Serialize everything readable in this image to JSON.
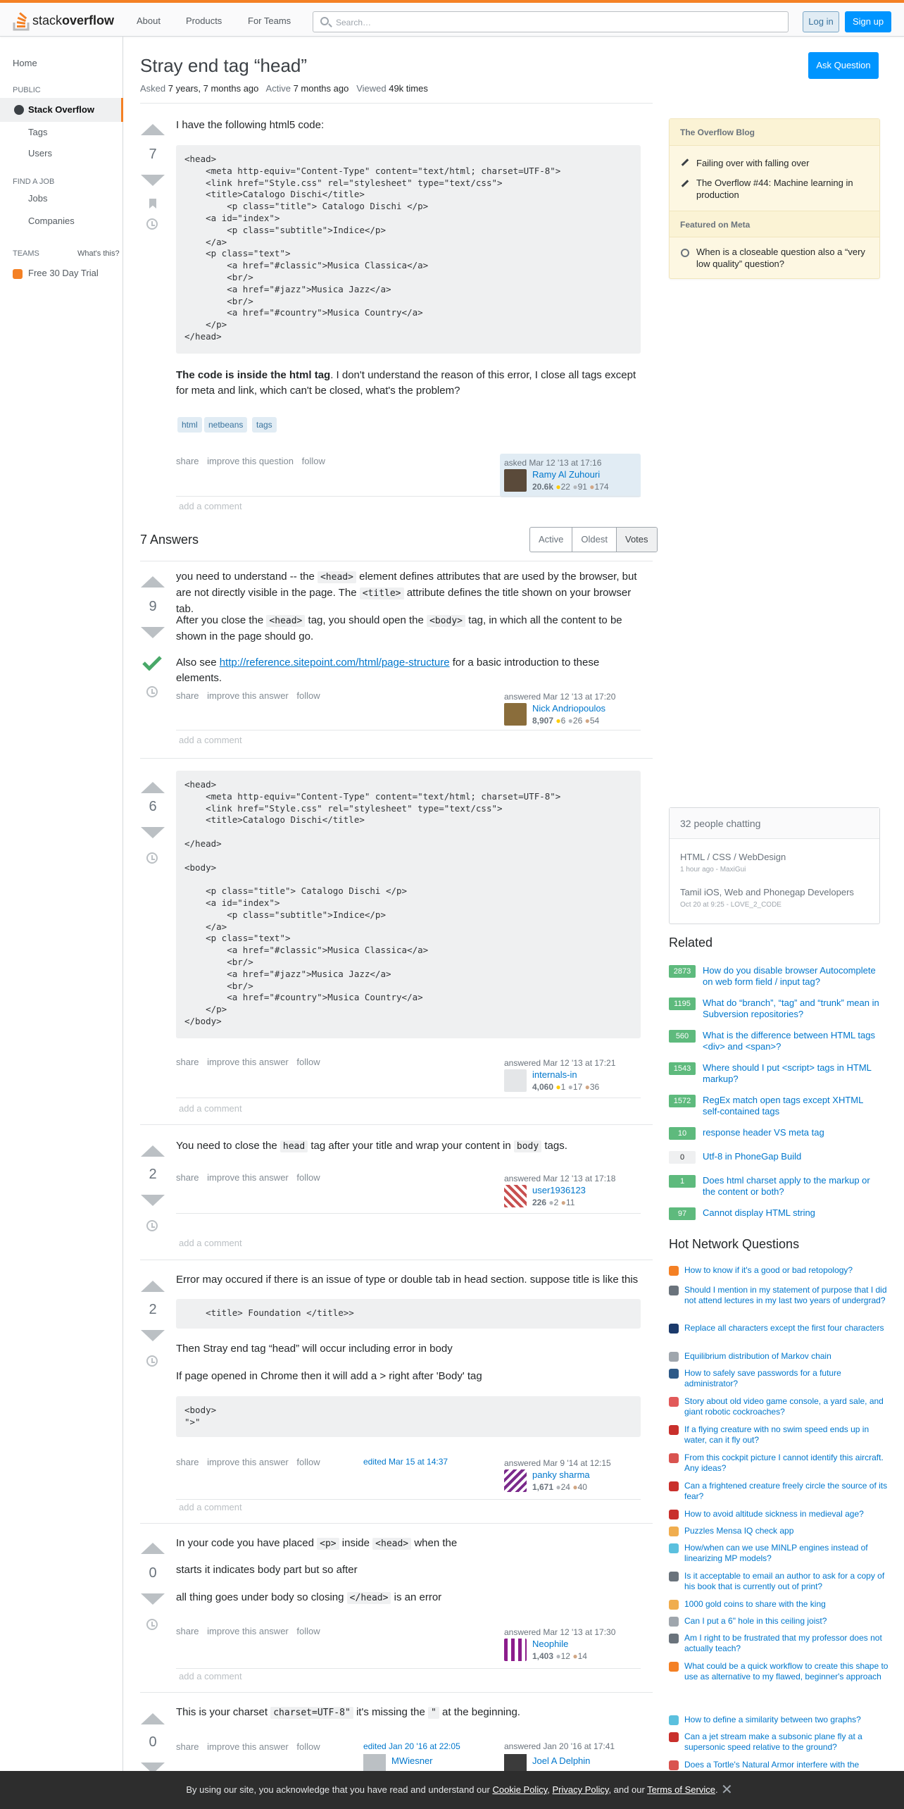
{
  "header": {
    "logo_text_1": "stack",
    "logo_text_2": "overflow",
    "nav": [
      "About",
      "Products",
      "For Teams"
    ],
    "search_placeholder": "Search…",
    "login": "Log in",
    "signup": "Sign up"
  },
  "leftnav": {
    "home": "Home",
    "public": "PUBLIC",
    "stack_overflow": "Stack Overflow",
    "tags": "Tags",
    "users": "Users",
    "find_job": "FIND A JOB",
    "jobs": "Jobs",
    "companies": "Companies",
    "teams": "TEAMS",
    "whats_this": "What's this?",
    "trial": "Free 30 Day Trial"
  },
  "question": {
    "title": "Stray end tag “head”",
    "ask_button": "Ask Question",
    "asked_label": "Asked",
    "asked_value": "7 years, 7 months ago",
    "active_label": "Active",
    "active_value": "7 months ago",
    "viewed_label": "Viewed",
    "viewed_value": "49k times",
    "votes": "7",
    "intro": "I have the following html5 code:",
    "code": "<head>\n    <meta http-equiv=\"Content-Type\" content=\"text/html; charset=UTF-8\">\n    <link href=\"Style.css\" rel=\"stylesheet\" type=\"text/css\">\n    <title>Catalogo Dischi</title>\n        <p class=\"title\"> Catalogo Dischi </p>\n    <a id=\"index\">\n        <p class=\"subtitle\">Indice</p>\n    </a>\n    <p class=\"text\">\n        <a href=\"#classic\">Musica Classica</a>\n        <br/>\n        <a href=\"#jazz\">Musica Jazz</a>\n        <br/>\n        <a href=\"#country\">Musica Country</a>\n    </p>\n</head>",
    "body_bold": "The code is inside the html tag",
    "body_rest": ". I don't understand the reason of this error, I close all tags except for meta and link, which can't be closed, what's the problem?",
    "tags": [
      "html",
      "netbeans",
      "tags"
    ],
    "menu": [
      "share",
      "improve this question",
      "follow"
    ],
    "owner": {
      "time": "asked Mar 12 '13 at 17:16",
      "name": "Ramy Al Zuhouri",
      "rep": "20.6k",
      "gold": "22",
      "silver": "91",
      "bronze": "174"
    },
    "add_comment": "add a comment"
  },
  "answers_header": {
    "count": "7 Answers",
    "tabs": [
      "Active",
      "Oldest",
      "Votes"
    ]
  },
  "answers": [
    {
      "votes": "9",
      "p1_a": "you need to understand -- the",
      "p1_code": "<head>",
      "p1_b": "element defines attributes that are used by the browser, but are not directly visible in the page. The",
      "p1_code2": "<title>",
      "p1_c": "attribute defines the title shown on your browser tab.",
      "p2_a": "After you close the",
      "p2_code": "<head>",
      "p2_b": "tag, you should open the",
      "p2_code2": "<body>",
      "p2_c": "tag, in which all the content to be shown in the page should go.",
      "p3_a": "Also see",
      "p3_link": "http://reference.sitepoint.com/html/page-structure",
      "p3_b": "for a basic introduction to these elements.",
      "menu": [
        "share",
        "improve this answer",
        "follow"
      ],
      "user": {
        "time": "answered Mar 12 '13 at 17:20",
        "name": "Nick Andriopoulos",
        "rep": "8,907",
        "gold": "6",
        "silver": "26",
        "bronze": "54"
      },
      "add_comment": "add a comment"
    },
    {
      "votes": "6",
      "code": "<head>\n    <meta http-equiv=\"Content-Type\" content=\"text/html; charset=UTF-8\">\n    <link href=\"Style.css\" rel=\"stylesheet\" type=\"text/css\">\n    <title>Catalogo Dischi</title>\n\n</head>\n\n<body>\n\n    <p class=\"title\"> Catalogo Dischi </p>\n    <a id=\"index\">\n        <p class=\"subtitle\">Indice</p>\n    </a>\n    <p class=\"text\">\n        <a href=\"#classic\">Musica Classica</a>\n        <br/>\n        <a href=\"#jazz\">Musica Jazz</a>\n        <br/>\n        <a href=\"#country\">Musica Country</a>\n    </p>\n</body>",
      "menu": [
        "share",
        "improve this answer",
        "follow"
      ],
      "user": {
        "time": "answered Mar 12 '13 at 17:21",
        "name": "internals-in",
        "rep": "4,060",
        "gold": "1",
        "silver": "17",
        "bronze": "36"
      },
      "add_comment": "add a comment"
    },
    {
      "votes": "2",
      "p_a": "You need to close the",
      "p_code": "head",
      "p_b": "tag after your title and wrap your content in",
      "p_code2": "body",
      "p_c": "tags.",
      "menu": [
        "share",
        "improve this answer",
        "follow"
      ],
      "user": {
        "time": "answered Mar 12 '13 at 17:18",
        "name": "user1936123",
        "rep": "226",
        "silver": "2",
        "bronze": "11"
      },
      "add_comment": "add a comment"
    },
    {
      "votes": "2",
      "p1": "Error may occured if there is an issue of type or double tab in head section. suppose title is like this",
      "code1": "    <title> Foundation </title>>",
      "p2": "Then Stray end tag “head” will occur including error in body",
      "p3": "If page opened in Chrome then it will add a > right after 'Body' tag",
      "code2": "<body>\n\">\"",
      "menu": [
        "share",
        "improve this answer",
        "follow"
      ],
      "edited": "edited Mar 15 at 14:37",
      "user": {
        "time": "answered Mar 9 '14 at 12:15",
        "name": "panky sharma",
        "rep": "1,671",
        "silver": "24",
        "bronze": "40"
      },
      "add_comment": "add a comment"
    },
    {
      "votes": "0",
      "p1_a": "In your code you have placed",
      "p1_code": "<p>",
      "p1_b": "inside",
      "p1_code2": "<head>",
      "p1_c": "when the",
      "p2": "starts it indicates body part but so after",
      "p3_a": "all thing goes under body so closing",
      "p3_code": "</head>",
      "p3_b": "is an error",
      "menu": [
        "share",
        "improve this answer",
        "follow"
      ],
      "user": {
        "time": "answered Mar 12 '13 at 17:30",
        "name": "Neophile",
        "rep": "1,403",
        "silver": "12",
        "bronze": "14"
      },
      "add_comment": "add a comment"
    },
    {
      "votes": "0",
      "p_a": "This is your charset",
      "p_code": "charset=UTF-8\"",
      "p_b": "it's missing the",
      "p_code2": "\"",
      "p_c": "at the beginning.",
      "menu": [
        "share",
        "improve this answer",
        "follow"
      ],
      "edited": "edited Jan 20 '16 at 22:05",
      "editor": "MWiesner",
      "user": {
        "time": "answered Jan 20 '16 at 17:41",
        "name": "Joel A Delphin"
      }
    }
  ],
  "sidebar": {
    "blog_header": "The Overflow Blog",
    "blog_items": [
      "Failing over with falling over",
      "The Overflow #44: Machine learning in production"
    ],
    "meta_header": "Featured on Meta",
    "meta_items": [
      "When is a closeable question also a “very low quality” question?"
    ],
    "chat_header": "32 people chatting",
    "chat_rooms": [
      {
        "name": "HTML / CSS / WebDesign",
        "sub": "1 hour ago - MaxiGui"
      },
      {
        "name": "Tamil iOS, Web and Phonegap Developers",
        "sub": "Oct 20 at 9:25 - LOVE_2_CODE"
      }
    ],
    "related_header": "Related",
    "related": [
      {
        "count": "2873",
        "title": "How do you disable browser Autocomplete on web form field / input tag?"
      },
      {
        "count": "1195",
        "title": "What do “branch”, “tag” and “trunk” mean in Subversion repositories?"
      },
      {
        "count": "560",
        "title": "What is the difference between HTML tags <div> and <span>?"
      },
      {
        "count": "1543",
        "title": "Where should I put <script> tags in HTML markup?"
      },
      {
        "count": "1572",
        "title": "RegEx match open tags except XHTML self-contained tags"
      },
      {
        "count": "10",
        "title": "response header VS meta tag"
      },
      {
        "count": "0",
        "title": "Utf-8 in PhoneGap Build"
      },
      {
        "count": "1",
        "title": "Does html charset apply to the markup or the content or both?"
      },
      {
        "count": "97",
        "title": "Cannot display HTML string"
      }
    ],
    "hnq_header": "Hot Network Questions",
    "hnq": [
      "How to know if it's a good or bad retopology?",
      "Should I mention in my statement of purpose that I did not attend lectures in my last two years of undergrad?",
      "Replace all characters except the first four characters",
      "Equilibrium distribution of Markov chain",
      "How to safely save passwords for a future administrator?",
      "Story about old video game console, a yard sale, and giant robotic cockroaches?",
      "If a flying creature with no swim speed ends up in water, can it fly out?",
      "From this cockpit picture I cannot identify this aircraft. Any ideas?",
      "Can a frightened creature freely circle the source of its fear?",
      "How to avoid altitude sickness in medieval age?",
      "Puzzles Mensa IQ check app",
      "How/when can we use MINLP engines instead of linearizing MP models?",
      "Is it acceptable to email an author to ask for a copy of his book that is currently out of print?",
      "1000 gold coins to share with the king",
      "Can I put a 6\" hole in this ceiling joist?",
      "Am I right to be frustrated that my professor does not actually teach?",
      "What could be a quick workflow to create this shape to use as alternative to my flawed, beginner's approach",
      "How to define a similarity between two graphs?",
      "Can a jet stream make a subsonic plane fly at a supersonic speed relative to the ground?",
      "Does a Tortle's Natural Armor interfere with the"
    ]
  },
  "cookie": {
    "text": "By using our site, you acknowledge that you have read and understand our",
    "l1": "Cookie Policy",
    "sep1": ",",
    "l2": "Privacy Policy",
    "sep2": ", and our",
    "l3": "Terms of Service",
    "end": "."
  }
}
